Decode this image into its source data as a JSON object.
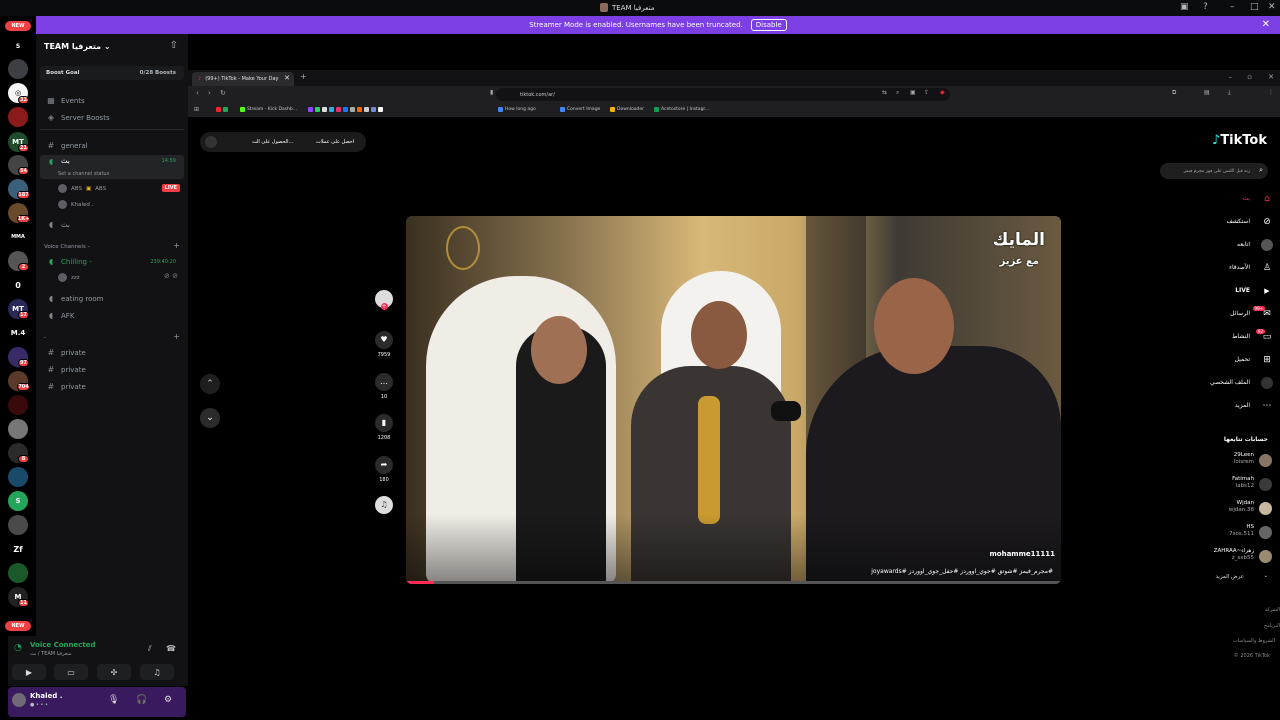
{
  "window": {
    "title": "TEAM متعرفيا"
  },
  "banner": {
    "text": "Streamer Mode is enabled. Usernames have been truncated.",
    "button": "Disable"
  },
  "rail": {
    "new_top": "NEW",
    "new_bottom": "NEW",
    "letters": [
      "S",
      "0",
      "M.4",
      "Zf"
    ],
    "badges": [
      "32",
      "21",
      "54",
      "187",
      "1K+",
      "2",
      "17",
      "97",
      "704",
      "8",
      "11"
    ]
  },
  "sidebar": {
    "server_name": "TEAM متعرفيا",
    "boost_goal": "Boost Goal",
    "boost_count": "0/28 Boosts",
    "events": "Events",
    "server_boosts": "Server Boosts",
    "channels": {
      "general": "general",
      "bt": "بث",
      "bt_time": "14:59",
      "status_hint": "Set a channel status",
      "user1": "ABS",
      "user1_tag": "ABS",
      "live": "LIVE",
      "user2": "Khaled .",
      "bt2": "بث"
    },
    "voice_category": "Voice Channels -",
    "voice": {
      "chilling": "Chilling -",
      "chilling_time": "239:40:20",
      "chilling_user": "zzz",
      "eating": "eating room",
      "afk": "AFK"
    },
    "private_category": "-",
    "private": [
      "private",
      "private",
      "private"
    ]
  },
  "voice_panel": {
    "status": "Voice Connected",
    "sub": "بث / TEAM متعرفيا"
  },
  "user_panel": {
    "name": "Khaled .",
    "status": "● • • •"
  },
  "browser": {
    "tab_title": "(99+) TikTok - Make Your Day",
    "url": "tiktok.com/ar/",
    "bookmarks": [
      "Stream - Kick Dashb...",
      "How long ago",
      "Convert Image",
      "Downloader",
      "Acetostore | Instagr..."
    ]
  },
  "tiktok": {
    "logo": "TikTok",
    "search_placeholder": "زنه قبل اللنس على فوز مجرم فيمز",
    "pill_a": "احصل على عملات",
    "pill_b": "الحصول على الت...",
    "nav": [
      {
        "label": "بث",
        "icon": "home-icon"
      },
      {
        "label": "استكشف",
        "icon": "compass-icon"
      },
      {
        "label": "اتابعه",
        "icon": "following-icon"
      },
      {
        "label": "الأصدقاء",
        "icon": "friends-icon"
      },
      {
        "label": "LIVE",
        "icon": "live-icon"
      },
      {
        "label": "الرسائل",
        "icon": "messages-icon",
        "badge": "99+"
      },
      {
        "label": "النشاط",
        "icon": "activity-icon",
        "badge": "92"
      },
      {
        "label": "تحميل",
        "icon": "upload-icon"
      },
      {
        "label": "الملف الشخصي",
        "icon": "profile-icon"
      },
      {
        "label": "المزيد",
        "icon": "more-icon"
      }
    ],
    "following_title": "حسابات تتابعها",
    "accounts": [
      {
        "name": "29Leen",
        "handle": "loisrem"
      },
      {
        "name": "Fatimah",
        "handle": "labs12"
      },
      {
        "name": "Wjdan",
        "handle": "wjdan.38"
      },
      {
        "name": "HS",
        "handle": "7sos.511"
      },
      {
        "name": "ZAHRAA~زهراء",
        "handle": "z_sxb55"
      }
    ],
    "see_more": "عرض المزيد",
    "footer": [
      "الشركة",
      "البرنامج",
      "الشروط والسياسات",
      "© 2026 TikTok"
    ],
    "video": {
      "watermark_title": "المايك",
      "watermark_sub": "مع عزيز",
      "author": "mohamme11111",
      "tags": "#مجرم_فيمز #شوتق #جوي_اووردز #حفل_جوي_اووردز #joyawards"
    },
    "actions": {
      "likes": "7959",
      "comments": "10",
      "saves": "1208",
      "shares": "180"
    }
  },
  "colors": {
    "accent": "#7b3fe4",
    "discord_green": "#23a55a",
    "tiktok_red": "#fe2c55"
  }
}
